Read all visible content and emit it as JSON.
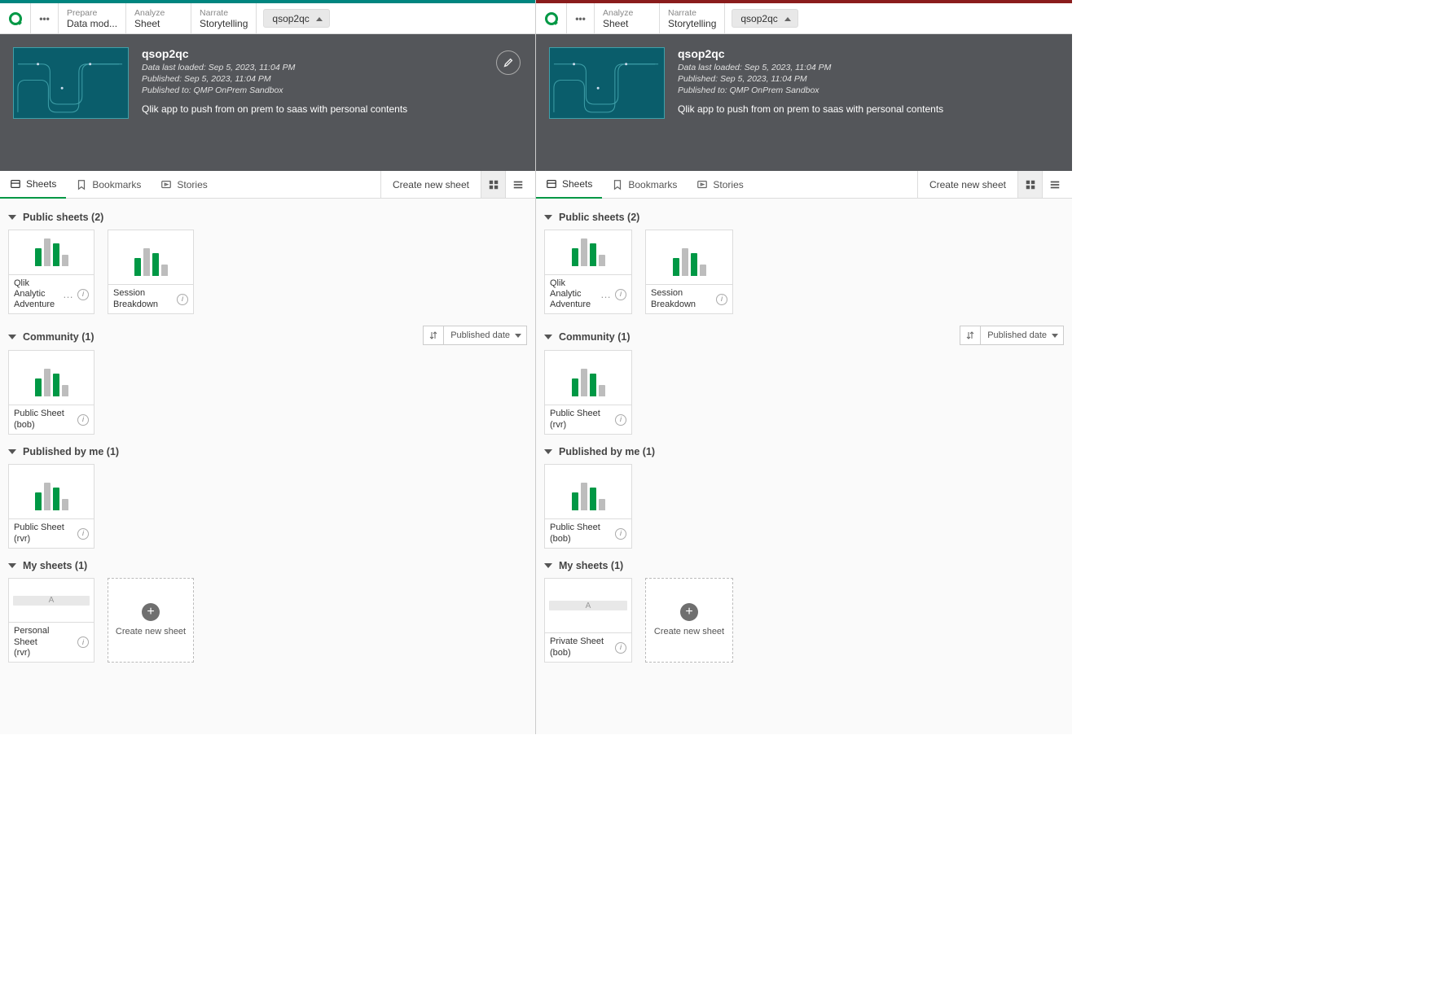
{
  "left": {
    "nav": {
      "steps": [
        {
          "top": "Prepare",
          "bot": "Data mod..."
        },
        {
          "top": "Analyze",
          "bot": "Sheet"
        },
        {
          "top": "Narrate",
          "bot": "Storytelling"
        }
      ],
      "app_name": "qsop2qc"
    },
    "hero": {
      "title": "qsop2qc",
      "meta1": "Data last loaded: Sep 5, 2023, 11:04 PM",
      "meta2": "Published: Sep 5, 2023, 11:04 PM",
      "meta3": "Published to: QMP OnPrem Sandbox",
      "desc": "Qlik app to push from on prem to saas with personal contents"
    },
    "tabs": {
      "sheets": "Sheets",
      "bookmarks": "Bookmarks",
      "stories": "Stories",
      "create": "Create new sheet"
    },
    "sections": {
      "public": "Public sheets (2)",
      "community": "Community (1)",
      "published_by_me": "Published by me (1)",
      "my": "My sheets (1)",
      "sort_label": "Published date",
      "create_card": "Create new sheet"
    },
    "cards": {
      "public": [
        {
          "title1": "Qlik Analytic",
          "title2": "Adventure",
          "more": true
        },
        {
          "title1": "Session",
          "title2": "Breakdown",
          "more": false
        }
      ],
      "community": [
        {
          "title": "Public Sheet (bob)"
        }
      ],
      "published_by_me": [
        {
          "title": "Public Sheet (rvr)"
        }
      ],
      "my": [
        {
          "title1": "Personal Sheet",
          "title2": "(rvr)"
        }
      ]
    }
  },
  "right": {
    "nav": {
      "steps": [
        {
          "top": "Analyze",
          "bot": "Sheet"
        },
        {
          "top": "Narrate",
          "bot": "Storytelling"
        }
      ],
      "app_name": "qsop2qc"
    },
    "hero": {
      "title": "qsop2qc",
      "meta1": "Data last loaded: Sep 5, 2023, 11:04 PM",
      "meta2": "Published: Sep 5, 2023, 11:04 PM",
      "meta3": "Published to: QMP OnPrem Sandbox",
      "desc": "Qlik app to push from on prem to saas with personal contents"
    },
    "tabs": {
      "sheets": "Sheets",
      "bookmarks": "Bookmarks",
      "stories": "Stories",
      "create": "Create new sheet"
    },
    "sections": {
      "public": "Public sheets (2)",
      "community": "Community (1)",
      "published_by_me": "Published by me (1)",
      "my": "My sheets (1)",
      "sort_label": "Published date",
      "create_card": "Create new sheet"
    },
    "cards": {
      "public": [
        {
          "title1": "Qlik Analytic",
          "title2": "Adventure",
          "more": true
        },
        {
          "title1": "Session",
          "title2": "Breakdown",
          "more": false
        }
      ],
      "community": [
        {
          "title": "Public Sheet (rvr)"
        }
      ],
      "published_by_me": [
        {
          "title": "Public Sheet (bob)"
        }
      ],
      "my": [
        {
          "title1": "Private Sheet",
          "title2": "(bob)"
        }
      ]
    }
  },
  "icons": {
    "placeholder_letter": "A"
  }
}
